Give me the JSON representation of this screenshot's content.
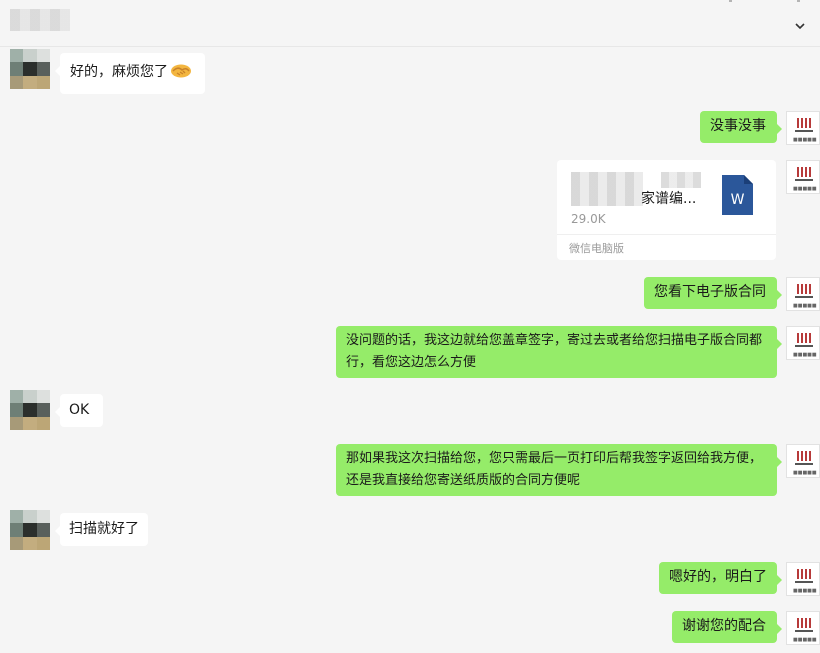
{
  "header": {
    "title_icon": "more-icon"
  },
  "colors": {
    "background": "#f5f5f5",
    "bubble_self": "#95ec69",
    "bubble_other": "#ffffff",
    "word_blue": "#2b579a"
  },
  "messages": [
    {
      "side": "left",
      "text": "好的，麻烦您了",
      "emoji": "handshake-icon"
    },
    {
      "side": "right",
      "text": "没事没事"
    },
    {
      "side": "right",
      "type": "file",
      "file_name": "家谱编...",
      "file_size": "29.0K",
      "source": "微信电脑版",
      "file_icon_letter": "W"
    },
    {
      "side": "right",
      "text": "您看下电子版合同"
    },
    {
      "side": "right",
      "text": "没问题的话，我这边就给您盖章签字，寄过去或者给您扫描电子版合同都行，看您这边怎么方便"
    },
    {
      "side": "left",
      "text": "OK"
    },
    {
      "side": "right",
      "text": "那如果我这次扫描给您，您只需最后一页打印后帮我签字返回给我方便，还是我直接给您寄送纸质版的合同方便呢"
    },
    {
      "side": "left",
      "text": "扫描就好了"
    },
    {
      "side": "right",
      "text": "嗯好的，明白了"
    },
    {
      "side": "right",
      "text": "谢谢您的配合"
    }
  ]
}
